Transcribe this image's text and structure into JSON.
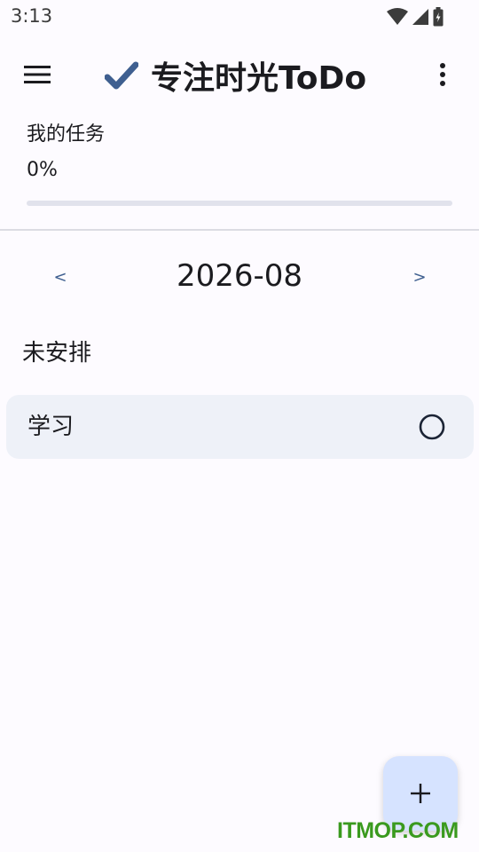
{
  "status_bar": {
    "time": "3:13",
    "icons": [
      "wifi-icon",
      "cell-signal-icon",
      "battery-icon"
    ]
  },
  "app_bar": {
    "title": "专注时光ToDo",
    "menu_icon": "hamburger-menu-icon",
    "logo_icon": "checkmark-icon",
    "more_icon": "more-vert-icon"
  },
  "progress": {
    "label": "我的任务",
    "percent_text": "0%",
    "value": 0
  },
  "calendar": {
    "prev_label": "<",
    "month": "2026-08",
    "next_label": ">"
  },
  "groups": [
    {
      "heading": "未安排",
      "tasks": [
        {
          "title": "学习",
          "done": false
        }
      ]
    }
  ],
  "fab": {
    "label": "+"
  },
  "watermark": "ITMOP.COM",
  "colors": {
    "accent": "#3f5f90",
    "card": "#eef1f8",
    "fab": "#d6e3ff",
    "track": "#e1e2ec",
    "watermark": "#3a9a1e"
  }
}
